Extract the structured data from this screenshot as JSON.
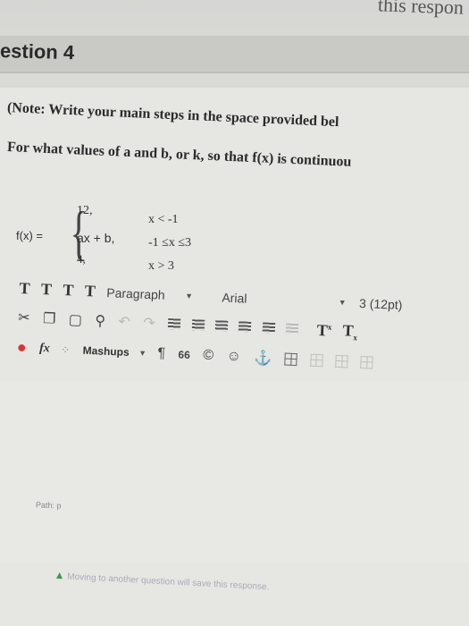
{
  "header": {
    "top_partial": "this respon",
    "question_title": "estion 4"
  },
  "note": {
    "text": "(Note: Write your main steps in the space provided bel"
  },
  "prompt": {
    "text": "For what values of a and b, or k, so that f(x) is continuou"
  },
  "function": {
    "label": "f(x) =",
    "cases": [
      {
        "value": "12,",
        "condition": "x < -1"
      },
      {
        "value": "ax + b,",
        "condition": "-1 ≤x ≤3"
      },
      {
        "value": "4,",
        "condition": "x > 3"
      }
    ]
  },
  "toolbar": {
    "row1": {
      "format_buttons": [
        "T",
        "T",
        "T",
        "T"
      ],
      "paragraph": "Paragraph",
      "font": "Arial",
      "size": "3 (12pt)"
    },
    "row2": {
      "icons": [
        "scissors-icon",
        "copy-icon",
        "paste-icon",
        "search-icon",
        "undo-icon",
        "redo-icon"
      ],
      "align_count": 6,
      "superscript": "T",
      "subscript": "T"
    },
    "row3": {
      "formula": "fx",
      "mashups": "Mashups",
      "pilcrow": "¶",
      "quote": "66"
    }
  },
  "status": {
    "path": "Path: p"
  },
  "footer": {
    "text": "Moving to another question will save this response."
  }
}
